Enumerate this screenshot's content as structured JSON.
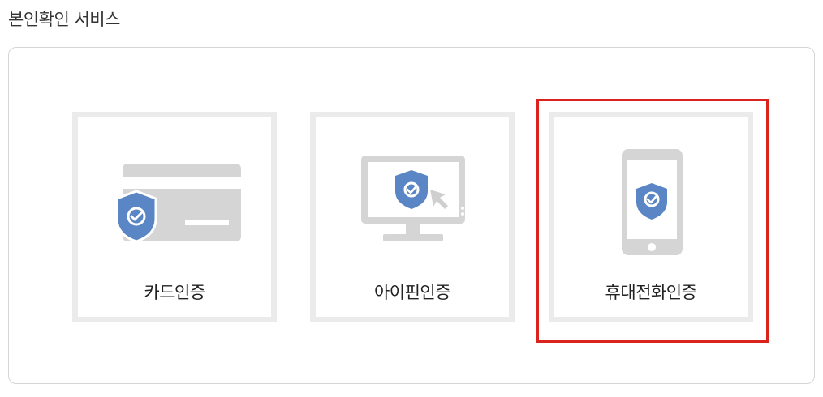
{
  "section": {
    "title": "본인확인 서비스"
  },
  "options": [
    {
      "label": "카드인증",
      "icon": "credit-card-shield-icon"
    },
    {
      "label": "아이핀인증",
      "icon": "monitor-shield-cursor-icon"
    },
    {
      "label": "휴대전화인증",
      "icon": "smartphone-shield-icon"
    }
  ],
  "selected_option": "휴대전화인증",
  "colors": {
    "icon_gray": "#d5d5d5",
    "shield_blue": "#5a86c5",
    "selection_border": "#d9231c",
    "tile_border": "#ebebeb"
  }
}
